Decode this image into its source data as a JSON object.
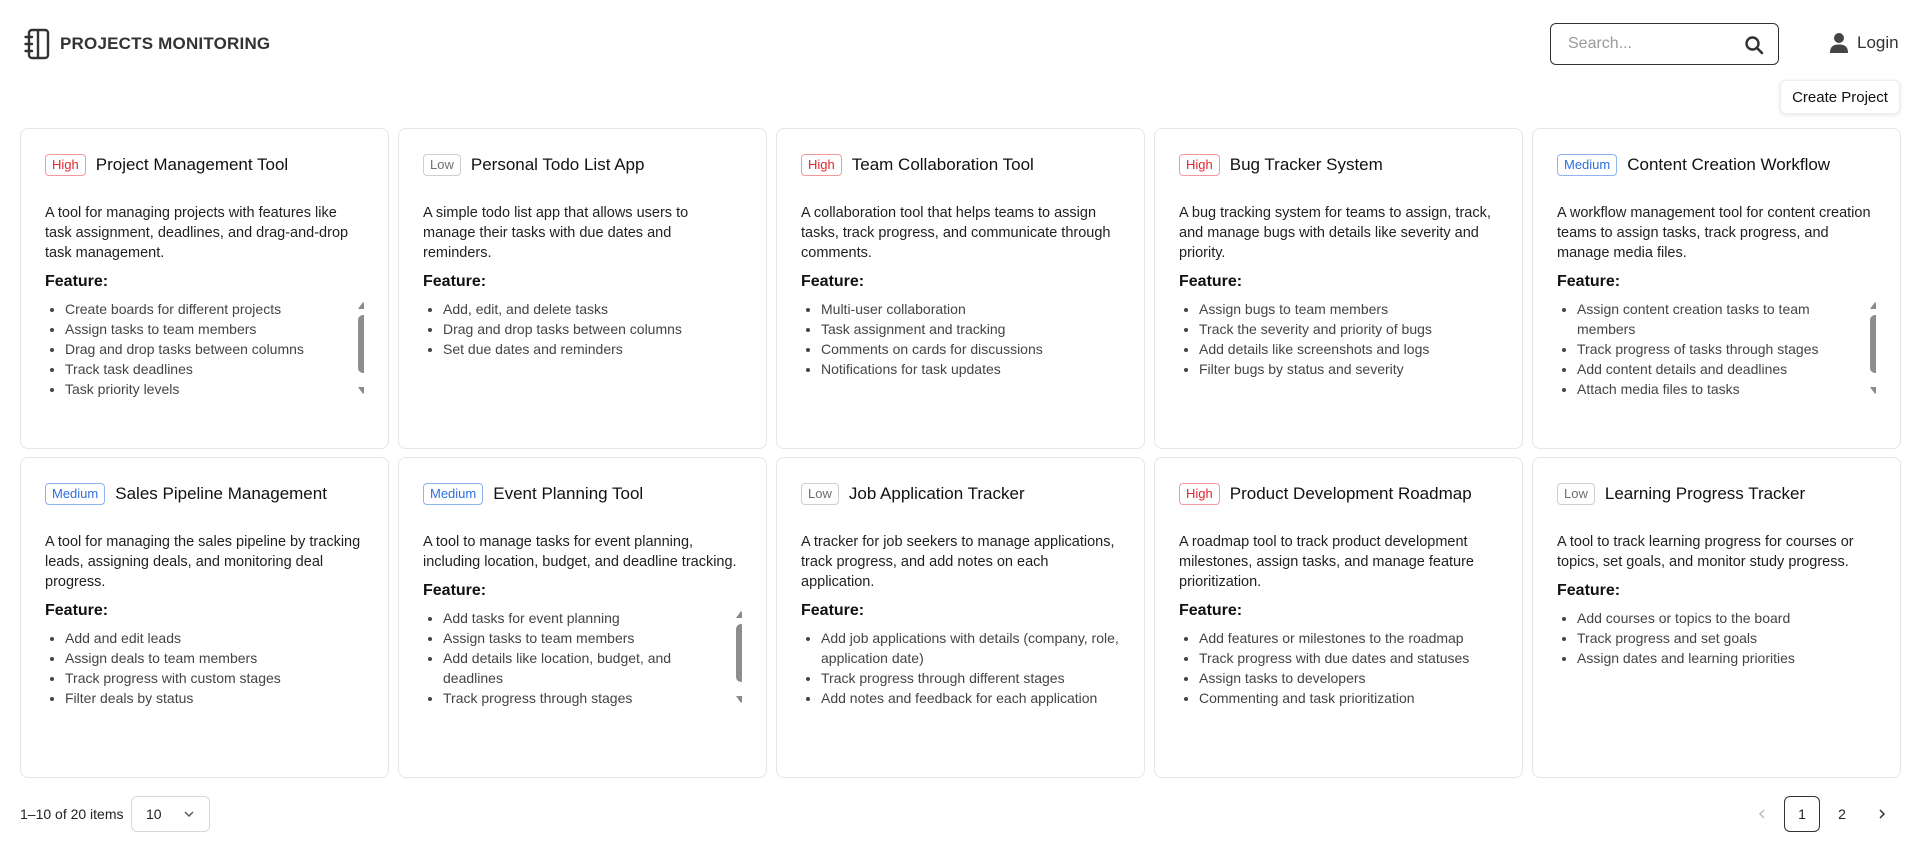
{
  "header": {
    "brand_title": "PROJECTS MONITORING",
    "search_placeholder": "Search...",
    "login_label": "Login",
    "create_button": "Create Project"
  },
  "colors": {
    "high": "#e0282e",
    "medium": "#2f6fe0",
    "low": "#6f6f6f"
  },
  "feature_heading": "Feature:",
  "cards": [
    {
      "priority": "High",
      "title": "Project Management Tool",
      "description": "A tool for managing projects with features like task assignment, deadlines, and drag-and-drop task management.",
      "features": [
        "Create boards for different projects",
        "Assign tasks to team members",
        "Drag and drop tasks between columns",
        "Track task deadlines",
        "Task priority levels"
      ]
    },
    {
      "priority": "Low",
      "title": "Personal Todo List App",
      "description": "A simple todo list app that allows users to manage their tasks with due dates and reminders.",
      "features": [
        "Add, edit, and delete tasks",
        "Drag and drop tasks between columns",
        "Set due dates and reminders"
      ]
    },
    {
      "priority": "High",
      "title": "Team Collaboration Tool",
      "description": "A collaboration tool that helps teams to assign tasks, track progress, and communicate through comments.",
      "features": [
        "Multi-user collaboration",
        "Task assignment and tracking",
        "Comments on cards for discussions",
        "Notifications for task updates"
      ]
    },
    {
      "priority": "High",
      "title": "Bug Tracker System",
      "description": "A bug tracking system for teams to assign, track, and manage bugs with details like severity and priority.",
      "features": [
        "Assign bugs to team members",
        "Track the severity and priority of bugs",
        "Add details like screenshots and logs",
        "Filter bugs by status and severity"
      ]
    },
    {
      "priority": "Medium",
      "title": "Content Creation Workflow",
      "description": "A workflow management tool for content creation teams to assign tasks, track progress, and manage media files.",
      "features": [
        "Assign content creation tasks to team members",
        "Track progress of tasks through stages",
        "Add content details and deadlines",
        "Attach media files to tasks"
      ]
    },
    {
      "priority": "Medium",
      "title": "Sales Pipeline Management",
      "description": "A tool for managing the sales pipeline by tracking leads, assigning deals, and monitoring deal progress.",
      "features": [
        "Add and edit leads",
        "Assign deals to team members",
        "Track progress with custom stages",
        "Filter deals by status"
      ]
    },
    {
      "priority": "Medium",
      "title": "Event Planning Tool",
      "description": "A tool to manage tasks for event planning, including location, budget, and deadline tracking.",
      "features": [
        "Add tasks for event planning",
        "Assign tasks to team members",
        "Add details like location, budget, and deadlines",
        "Track progress through stages"
      ]
    },
    {
      "priority": "Low",
      "title": "Job Application Tracker",
      "description": "A tracker for job seekers to manage applications, track progress, and add notes on each application.",
      "features": [
        "Add job applications with details (company, role, application date)",
        "Track progress through different stages",
        "Add notes and feedback for each application"
      ]
    },
    {
      "priority": "High",
      "title": "Product Development Roadmap",
      "description": "A roadmap tool to track product development milestones, assign tasks, and manage feature prioritization.",
      "features": [
        "Add features or milestones to the roadmap",
        "Track progress with due dates and statuses",
        "Assign tasks to developers",
        "Commenting and task prioritization"
      ]
    },
    {
      "priority": "Low",
      "title": "Learning Progress Tracker",
      "description": "A tool to track learning progress for courses or topics, set goals, and monitor study progress.",
      "features": [
        "Add courses or topics to the board",
        "Track progress and set goals",
        "Assign dates and learning priorities"
      ]
    }
  ],
  "scrollable_cards": [
    0,
    4,
    6
  ],
  "footer": {
    "range_text": "1–10 of 20 items",
    "page_size": "10",
    "pages": [
      "1",
      "2"
    ],
    "active_page": "1"
  }
}
